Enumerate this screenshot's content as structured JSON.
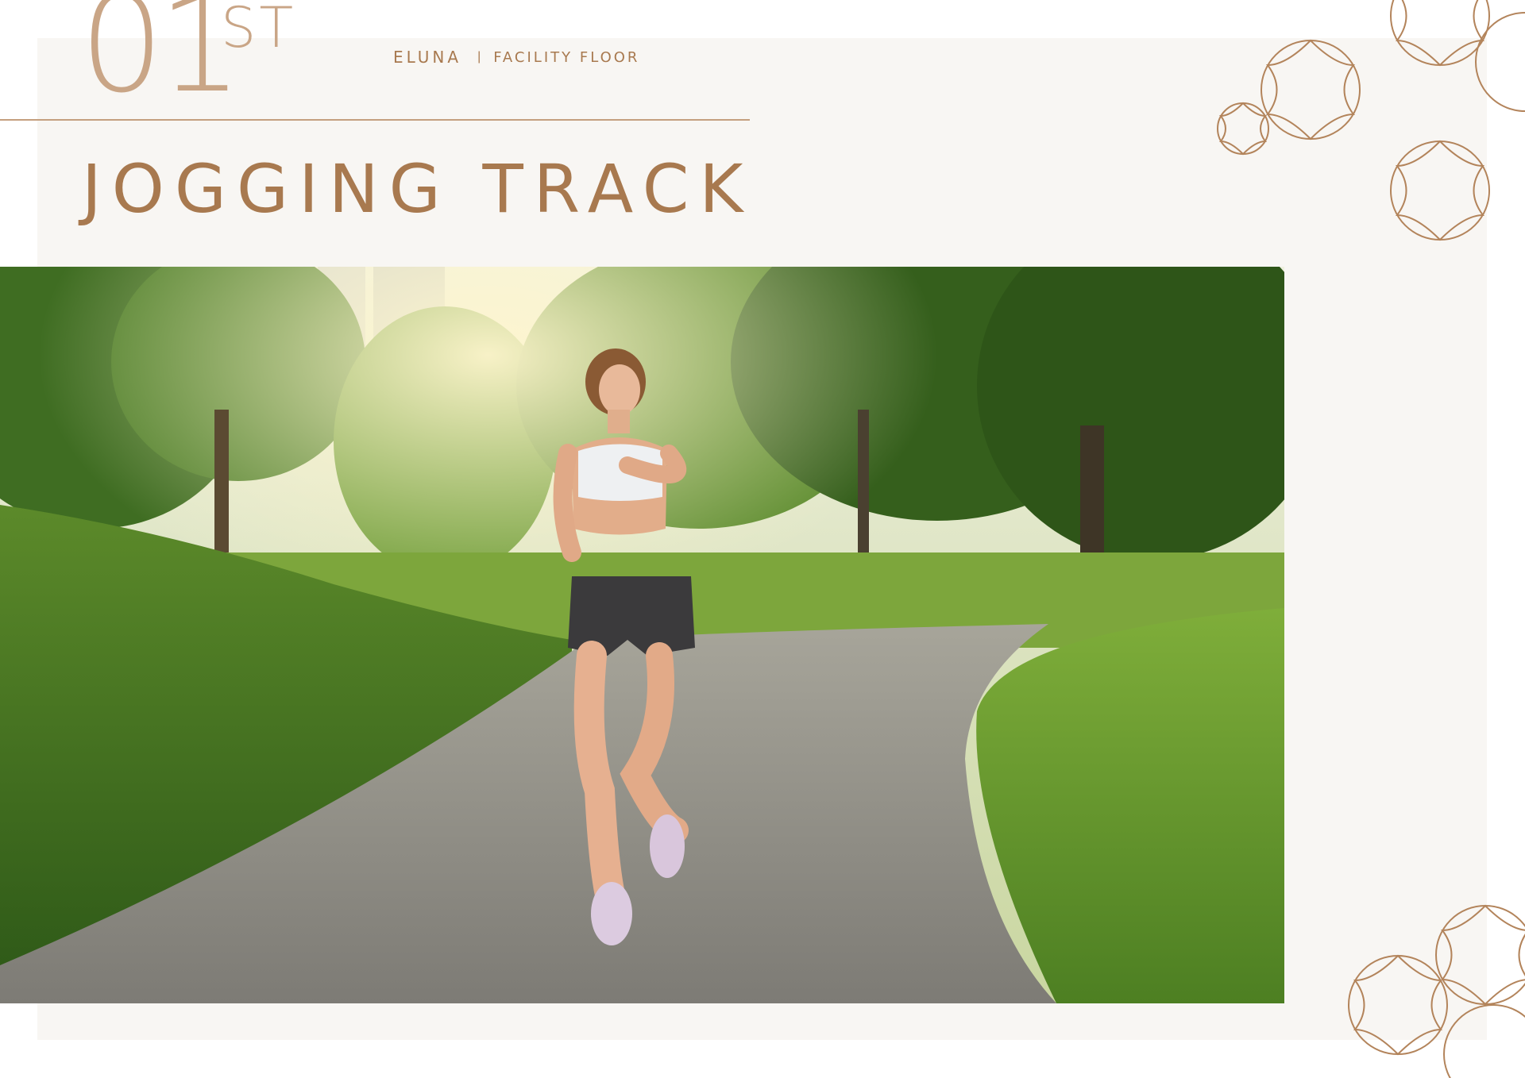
{
  "header": {
    "floor_number": "01",
    "floor_suffix": "ST",
    "brand_name": "ELUNA",
    "separator": "|",
    "section_label": "FACILITY FLOOR"
  },
  "facility": {
    "title": "JOGGING TRACK"
  },
  "colors": {
    "accent": "#a8794f",
    "accent_light": "#c9a586",
    "panel_bg": "#f8f6f3"
  }
}
